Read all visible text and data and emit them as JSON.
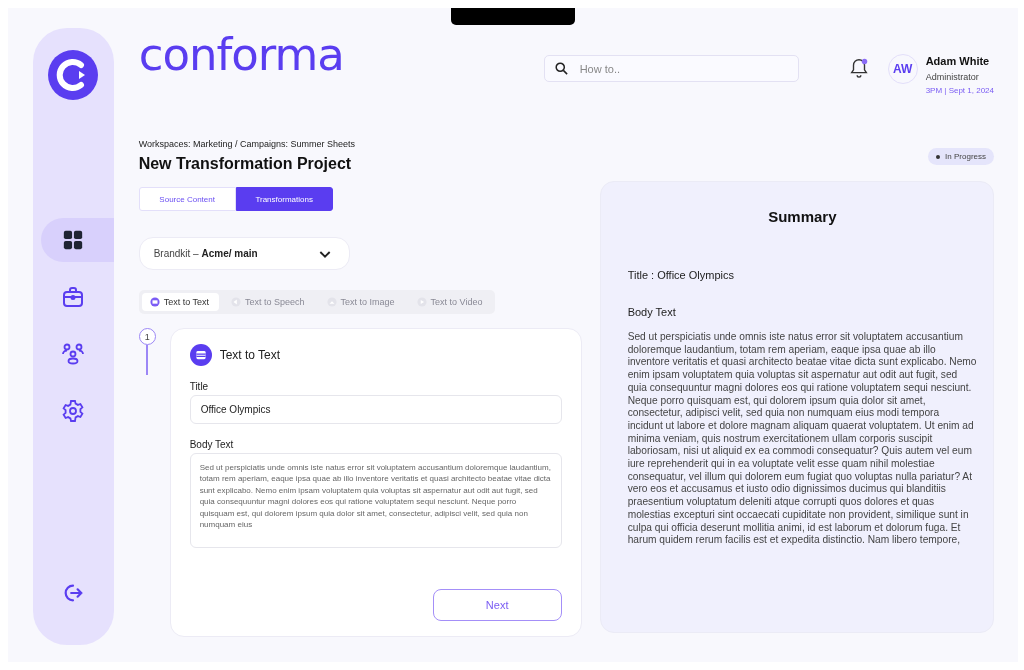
{
  "sidebar": {
    "items": [
      {
        "kind": "grid",
        "selected": true
      },
      {
        "kind": "briefcase",
        "selected": false
      },
      {
        "kind": "people",
        "selected": false
      },
      {
        "kind": "gear",
        "selected": false
      }
    ],
    "footer": {
      "kind": "logout"
    }
  },
  "header": {
    "logo": "conforma",
    "search": {
      "placeholder": "How to.."
    },
    "notifications": {
      "unread": true
    },
    "user": {
      "initials": "AW",
      "name": "Adam White",
      "role": "Administrator",
      "timestamp": "3PM | Sept 1, 2024"
    }
  },
  "breadcrumb": "Workspaces: Marketing / Campaigns: Summer Sheets",
  "title": "New Transformation Project",
  "status": "In Progress",
  "tabs": [
    {
      "label": "Source Content",
      "selected": false
    },
    {
      "label": "Transformations",
      "selected": true
    }
  ],
  "brandkit": {
    "label": "Brandkit – ",
    "value": "Acme/ main"
  },
  "modes": [
    {
      "label": "Text to Text",
      "kind": "text",
      "selected": true
    },
    {
      "label": "Text to Speech",
      "kind": "speech",
      "selected": false
    },
    {
      "label": "Text to Image",
      "kind": "image",
      "selected": false
    },
    {
      "label": "Text to Video",
      "kind": "video",
      "selected": false
    }
  ],
  "step": {
    "number": "1",
    "heading": "Text to Text",
    "fields": [
      {
        "label": "Title",
        "kind": "input",
        "value": "Office Olympics"
      },
      {
        "label": "Body Text",
        "kind": "textarea",
        "value": "Sed ut perspiciatis unde omnis iste natus error sit voluptatem accusantium doloremque laudantium, totam rem aperiam, eaque ipsa quae ab illo inventore veritatis et quasi architecto beatae vitae dicta sunt explicabo. Nemo enim ipsam voluptatem quia voluptas sit aspernatur aut odit aut fugit, sed quia consequuntur magni dolores eos qui ratione voluptatem sequi nesciunt. Neque porro quisquam est, qui dolorem ipsum quia dolor sit amet, consectetur, adipisci velit, sed quia non numquam eius"
      }
    ],
    "button": "Next"
  },
  "summary": {
    "heading": "Summary",
    "title_line": "Title : Office Olympics",
    "body_label": "Body Text",
    "body": "Sed ut perspiciatis unde omnis iste natus error sit voluptatem accusantium doloremque laudantium, totam rem aperiam, eaque ipsa quae ab illo inventore veritatis et quasi architecto beatae vitae dicta sunt explicabo. Nemo enim ipsam voluptatem quia voluptas sit aspernatur aut odit aut fugit, sed quia consequuntur magni dolores eos qui ratione voluptatem sequi nesciunt. Neque porro quisquam est, qui dolorem ipsum quia dolor sit amet, consectetur, adipisci velit, sed quia non numquam eius modi tempora incidunt ut labore et dolore magnam aliquam quaerat voluptatem. Ut enim ad minima veniam, quis nostrum exercitationem ullam corporis suscipit laboriosam, nisi ut aliquid ex ea commodi consequatur? Quis autem vel eum iure reprehenderit qui in ea voluptate velit esse quam nihil molestiae consequatur, vel illum qui dolorem eum fugiat quo voluptas nulla pariatur? At vero eos et accusamus et iusto odio dignissimos ducimus qui blanditiis praesentium voluptatum deleniti atque corrupti quos dolores et quas molestias excepturi sint occaecati cupiditate non provident, similique sunt in culpa qui officia deserunt mollitia animi, id est laborum et dolorum fuga. Et harum quidem rerum facilis est et expedita distinctio. Nam libero tempore,"
  }
}
